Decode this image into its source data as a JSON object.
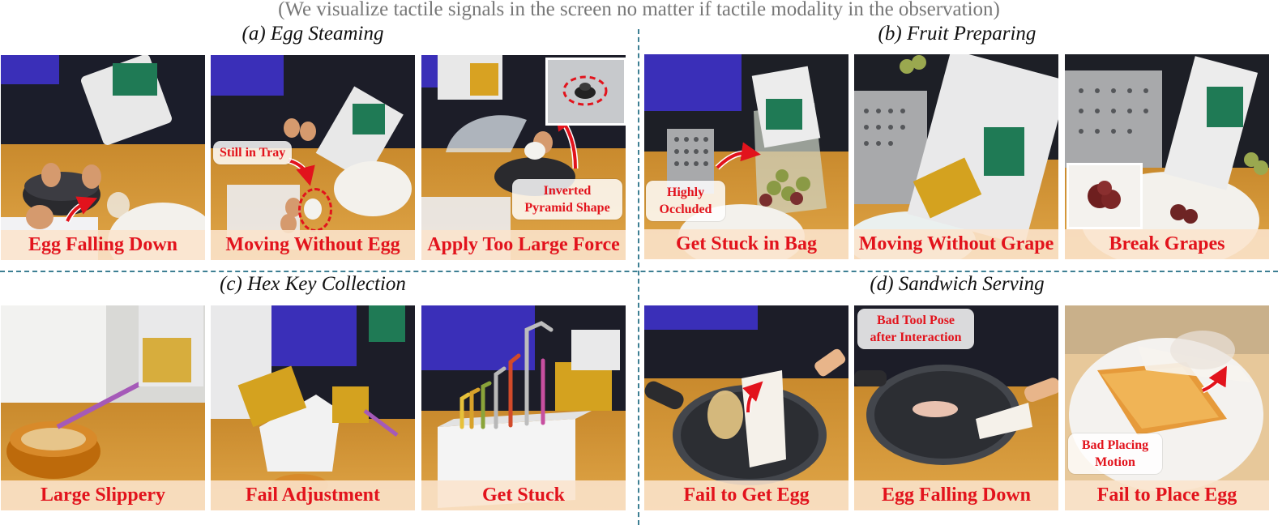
{
  "header_note": "(We visualize tactile signals in the screen no matter if tactile modality in the observation)",
  "sections": {
    "a": {
      "title": "(a) Egg Steaming",
      "panels": [
        {
          "label": "Egg Falling Down"
        },
        {
          "label": "Moving Without Egg",
          "callout": "Still in Tray"
        },
        {
          "label": "Apply Too Large Force",
          "callout_lines": [
            "Inverted",
            "Pyramid Shape"
          ]
        }
      ]
    },
    "b": {
      "title": "(b) Fruit Preparing",
      "panels": [
        {
          "label": "Get Stuck in Bag",
          "callout_lines": [
            "Highly",
            "Occluded"
          ]
        },
        {
          "label": "Moving Without Grape"
        },
        {
          "label": "Break Grapes"
        }
      ]
    },
    "c": {
      "title": "(c) Hex Key Collection",
      "panels": [
        {
          "label": "Large Slippery"
        },
        {
          "label": "Fail Adjustment"
        },
        {
          "label": "Get Stuck"
        }
      ]
    },
    "d": {
      "title": "(d) Sandwich Serving",
      "panels": [
        {
          "label": "Fail to Get Egg"
        },
        {
          "label": "Egg Falling Down",
          "callout_lines": [
            "Bad Tool Pose",
            "after Interaction"
          ]
        },
        {
          "label": "Fail to Place Egg",
          "callout_lines": [
            "Bad Placing",
            "Motion"
          ]
        }
      ]
    }
  },
  "colors": {
    "label_text": "#e2131c",
    "label_band": "#fae4cd",
    "divider": "#3d7f93",
    "caption_gray": "#777777"
  }
}
